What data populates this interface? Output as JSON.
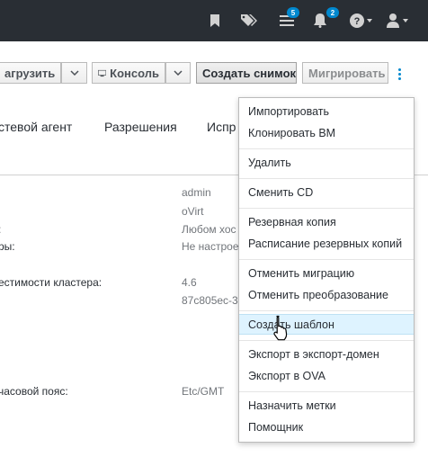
{
  "topbar": {
    "events_badge": "5",
    "notifications_badge": "2"
  },
  "toolbar": {
    "load_label": "агрузить",
    "console_label": "Консоль",
    "snapshot_label": "Создать снимок",
    "migrate_label": "Мигрировать"
  },
  "tabs": [
    "стевой агент",
    "Разрешения",
    "Испр"
  ],
  "details": [
    {
      "label": "",
      "value": "admin"
    },
    {
      "label": "",
      "value": "oVirt"
    },
    {
      "label": ":",
      "value": "Любом хос"
    },
    {
      "label": "ры:",
      "value": "Не настрое"
    },
    {
      "label": "естимости кластера:",
      "value": "4.6"
    },
    {
      "label": "",
      "value": "87c805ec-3"
    },
    {
      "label": "часовой пояс:",
      "value": "Etc/GMT"
    }
  ],
  "menu": {
    "items": [
      "Импортировать",
      "Клонировать ВМ",
      "Удалить",
      "Сменить CD",
      "Резервная копия",
      "Расписание резервных копий",
      "Отменить миграцию",
      "Отменить преобразование",
      "Создать шаблон",
      "Экспорт в экспорт-домен",
      "Экспорт в OVA",
      "Назначить метки",
      "Помощник"
    ],
    "highlighted": "Создать шаблон"
  },
  "icons": {
    "bookmark": "bookmark-icon",
    "tags": "tags-icon",
    "tasks": "tasks-icon",
    "notifications": "bell-icon",
    "help": "help-icon",
    "user": "user-icon",
    "console": "monitor-icon",
    "kebab": "kebab-icon",
    "cursor": "hand-pointer-icon"
  },
  "colors": {
    "topbar": "#292e34",
    "badge": "#0088ce",
    "highlight": "#def3ff",
    "kebab": "#0088ce"
  }
}
